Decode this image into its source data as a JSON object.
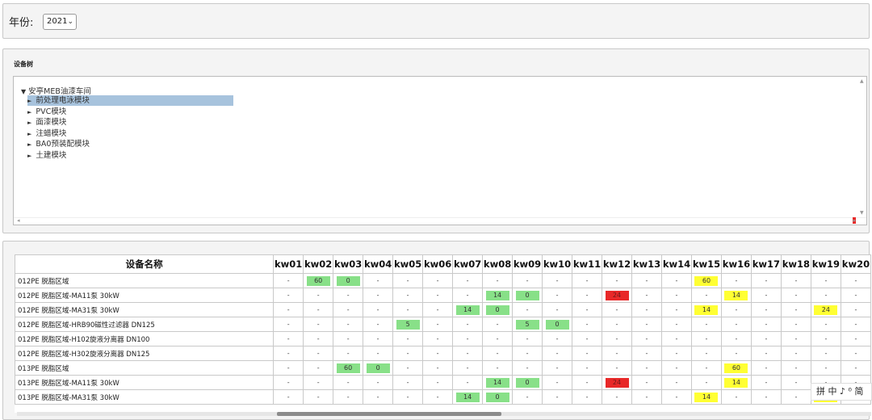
{
  "filter": {
    "year_label": "年份:",
    "year_value": "2021"
  },
  "tree": {
    "title": "设备树",
    "root": "安亭MEB油漆车间",
    "nodes": [
      "前处理电泳模块",
      "PVC模块",
      "面漆模块",
      "注蜡模块",
      "BA0预装配模块",
      "土建模块"
    ],
    "selected_index": 0
  },
  "table": {
    "name_header": "设备名称",
    "weeks": [
      "kw01",
      "kw02",
      "kw03",
      "kw04",
      "kw05",
      "kw06",
      "kw07",
      "kw08",
      "kw09",
      "kw10",
      "kw11",
      "kw12",
      "kw13",
      "kw14",
      "kw15",
      "kw16",
      "kw17",
      "kw18",
      "kw19",
      "kw20"
    ],
    "rows": [
      {
        "name": "012PE 脱脂区域",
        "cells": [
          "-",
          "60|g",
          "0|g",
          "-",
          "-",
          "-",
          "-",
          "-",
          "-",
          "-",
          "-",
          "-",
          "-",
          "-",
          "60|y",
          "-",
          "-",
          "-",
          "-",
          "-"
        ]
      },
      {
        "name": "012PE 脱脂区域-MA11泵 30kW",
        "cells": [
          "-",
          "-",
          "-",
          "-",
          "-",
          "-",
          "-",
          "14|g",
          "0|g",
          "-",
          "-",
          "24|r",
          "-",
          "-",
          "-",
          "14|y",
          "-",
          "-",
          "-",
          "-"
        ]
      },
      {
        "name": "012PE 脱脂区域-MA31泵 30kW",
        "cells": [
          "-",
          "-",
          "-",
          "-",
          "-",
          "-",
          "14|g",
          "0|g",
          "-",
          "-",
          "-",
          "-",
          "-",
          "-",
          "14|y",
          "-",
          "-",
          "-",
          "24|y",
          "-"
        ]
      },
      {
        "name": "012PE 脱脂区域-HRB90磁性过滤器 DN125",
        "cells": [
          "-",
          "-",
          "-",
          "-",
          "5|g",
          "-",
          "-",
          "-",
          "5|g",
          "0|g",
          "-",
          "-",
          "-",
          "-",
          "-",
          "-",
          "-",
          "-",
          "-",
          "-"
        ]
      },
      {
        "name": "012PE 脱脂区域-H102旋液分离器 DN100",
        "cells": [
          "-",
          "-",
          "-",
          "-",
          "-",
          "-",
          "-",
          "-",
          "-",
          "-",
          "-",
          "-",
          "-",
          "-",
          "-",
          "-",
          "-",
          "-",
          "-",
          "-"
        ]
      },
      {
        "name": "012PE 脱脂区域-H302旋液分离器 DN125",
        "cells": [
          "-",
          "-",
          "-",
          "-",
          "-",
          "-",
          "-",
          "-",
          "-",
          "-",
          "-",
          "-",
          "-",
          "-",
          "-",
          "-",
          "-",
          "-",
          "-",
          "-"
        ]
      },
      {
        "name": "013PE 脱脂区域",
        "cells": [
          "-",
          "-",
          "60|g",
          "0|g",
          "-",
          "-",
          "-",
          "-",
          "-",
          "-",
          "-",
          "-",
          "-",
          "-",
          "-",
          "60|y",
          "-",
          "-",
          "-",
          "-"
        ]
      },
      {
        "name": "013PE 脱脂区域-MA11泵 30kW",
        "cells": [
          "-",
          "-",
          "-",
          "-",
          "-",
          "-",
          "-",
          "14|g",
          "0|g",
          "-",
          "-",
          "24|r",
          "-",
          "-",
          "-",
          "14|y",
          "-",
          "-",
          "-",
          "-"
        ]
      },
      {
        "name": "013PE 脱脂区域-MA31泵 30kW",
        "cells": [
          "-",
          "-",
          "-",
          "-",
          "-",
          "-",
          "14|g",
          "0|g",
          "-",
          "-",
          "-",
          "-",
          "-",
          "-",
          "14|y",
          "-",
          "-",
          "-",
          "24|y",
          "-"
        ]
      }
    ]
  },
  "ime": {
    "text": "拼 中 ♪ ⁰ 简"
  },
  "colors": {
    "green": "#88e088",
    "red": "#e82828",
    "yellow": "#ffff33",
    "selected": "#a7c3dd"
  }
}
